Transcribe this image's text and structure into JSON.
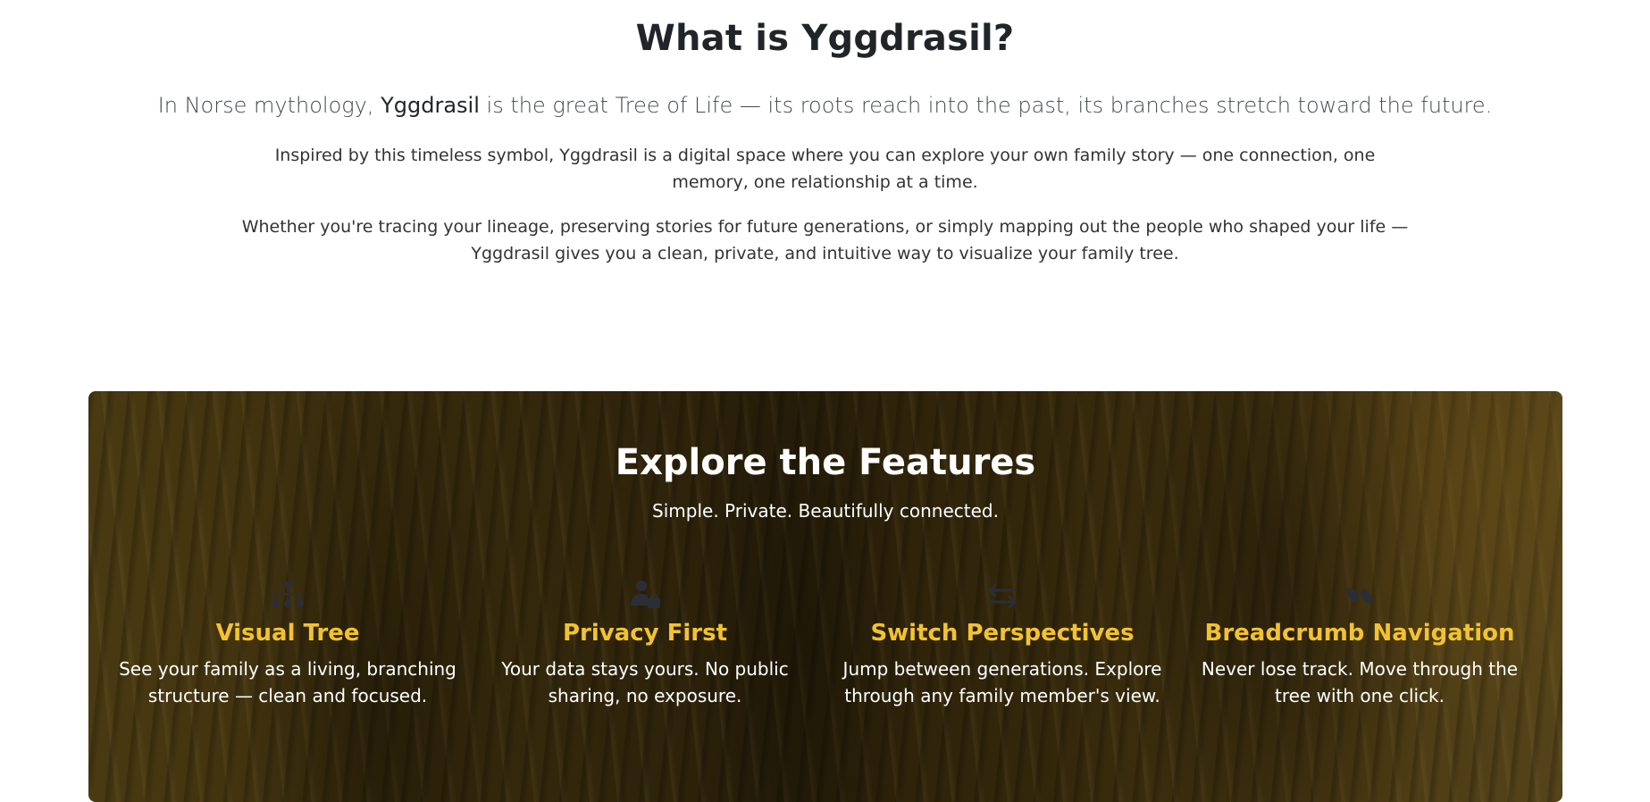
{
  "about": {
    "title": "What is Yggdrasil?",
    "lead_prefix": "In Norse mythology, ",
    "lead_name": "Yggdrasil",
    "lead_suffix": " is the great Tree of Life — its roots reach into the past, its branches stretch toward the future.",
    "paragraph1": "Inspired by this timeless symbol, Yggdrasil is a digital space where you can explore your own family story — one connection, one memory, one relationship at a time.",
    "paragraph2": "Whether you're tracing your lineage, preserving stories for future generations, or simply mapping out the people who shaped your life — Yggdrasil gives you a clean, private, and intuitive way to visualize your family tree."
  },
  "features": {
    "title": "Explore the Features",
    "subtitle": "Simple. Private. Beautifully connected.",
    "accent_color": "#f2c232",
    "items": [
      {
        "icon": "sitemap-icon",
        "title": "Visual Tree",
        "text": "See your family as a living, branching structure — clean and focused."
      },
      {
        "icon": "user-lock-icon",
        "title": "Privacy First",
        "text": "Your data stays yours. No public sharing, no exposure."
      },
      {
        "icon": "exchange-arrows-icon",
        "title": "Switch Perspectives",
        "text": "Jump between generations. Explore through any family member's view."
      },
      {
        "icon": "shoe-prints-icon",
        "title": "Breadcrumb Navigation",
        "text": "Never lose track. Move through the tree with one click."
      }
    ]
  }
}
